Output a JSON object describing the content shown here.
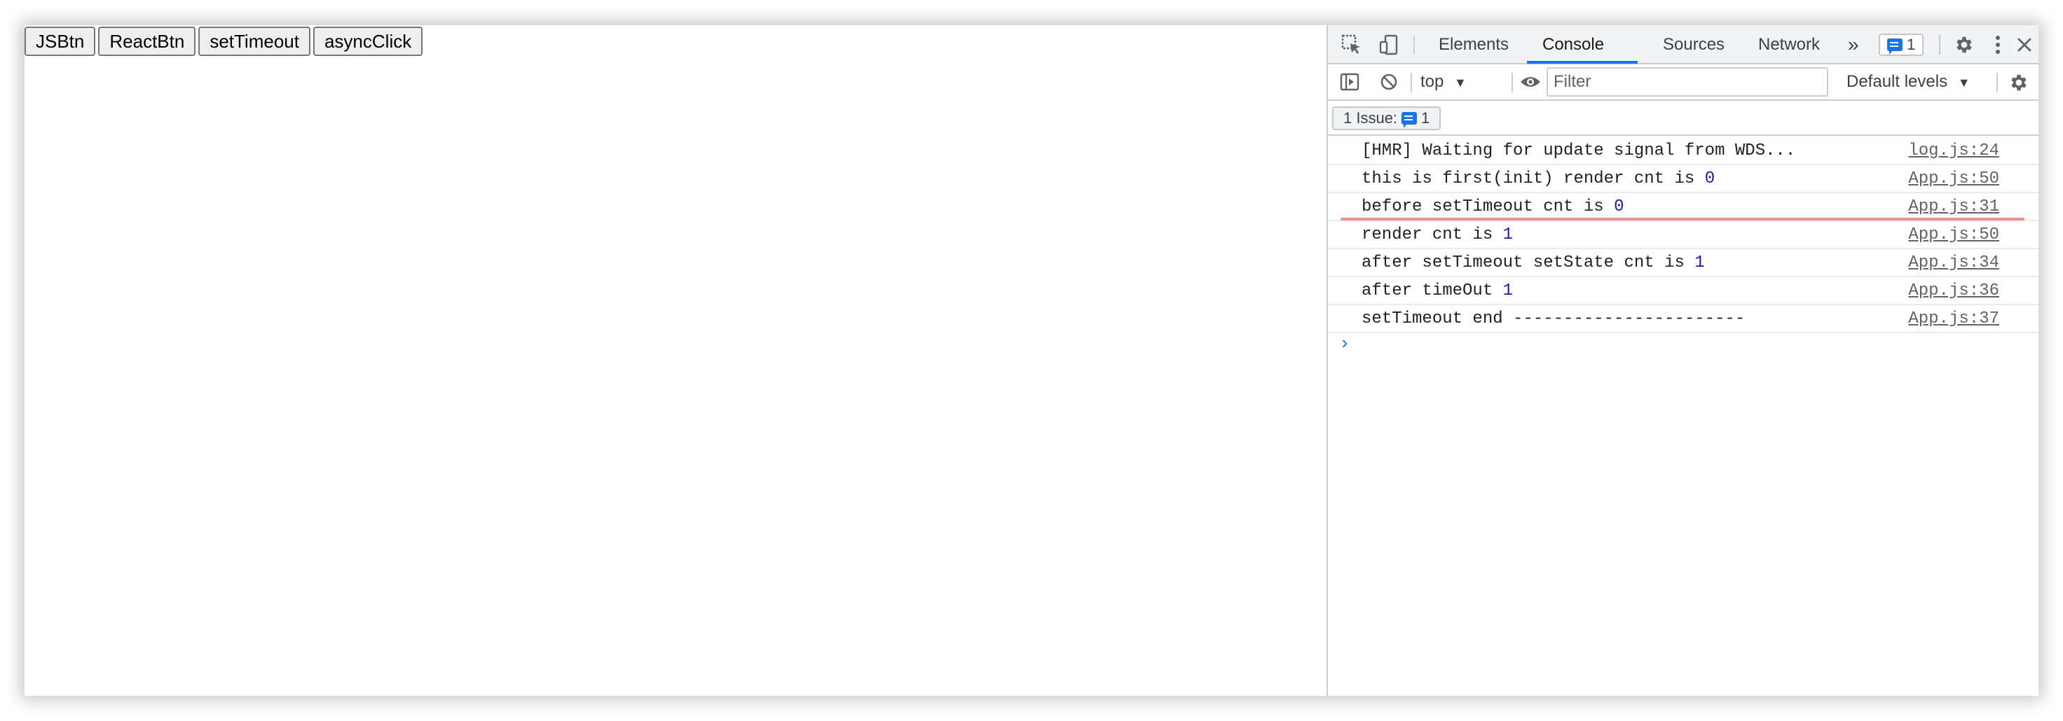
{
  "page": {
    "buttons": [
      {
        "label": "JSBtn"
      },
      {
        "label": "ReactBtn"
      },
      {
        "label": "setTimeout"
      },
      {
        "label": "asyncClick"
      }
    ]
  },
  "devtools": {
    "tabs": [
      {
        "label": "Elements",
        "active": false
      },
      {
        "label": "Console",
        "active": true
      },
      {
        "label": "Sources",
        "active": false
      },
      {
        "label": "Network",
        "active": false
      }
    ],
    "more_tabs": "»",
    "issues_badge_count": "1",
    "toolbar": {
      "context": "top",
      "filter_placeholder": "Filter",
      "levels": "Default levels"
    },
    "issues_bar": {
      "label": "1 Issue:",
      "count": "1"
    },
    "console": {
      "rows": [
        {
          "text": "[HMR] Waiting for update signal from WDS...",
          "num": "",
          "source": "log.js:24"
        },
        {
          "text": "this is first(init) render cnt is ",
          "num": "0",
          "source": "App.js:50"
        },
        {
          "text": "before setTimeout cnt is ",
          "num": "0",
          "source": "App.js:31"
        },
        {
          "text": "render cnt is ",
          "num": "1",
          "source": "App.js:50"
        },
        {
          "text": "after setTimeout setState cnt is ",
          "num": "1",
          "source": "App.js:34"
        },
        {
          "text": "after timeOut ",
          "num": "1",
          "source": "App.js:36"
        },
        {
          "text": "setTimeout end -----------------------",
          "num": "",
          "source": "App.js:37"
        }
      ],
      "prompt": "›"
    },
    "colors": {
      "accent": "#1a73e8",
      "number": "#1a1aa6",
      "highlight": "#ef8f8f"
    }
  }
}
